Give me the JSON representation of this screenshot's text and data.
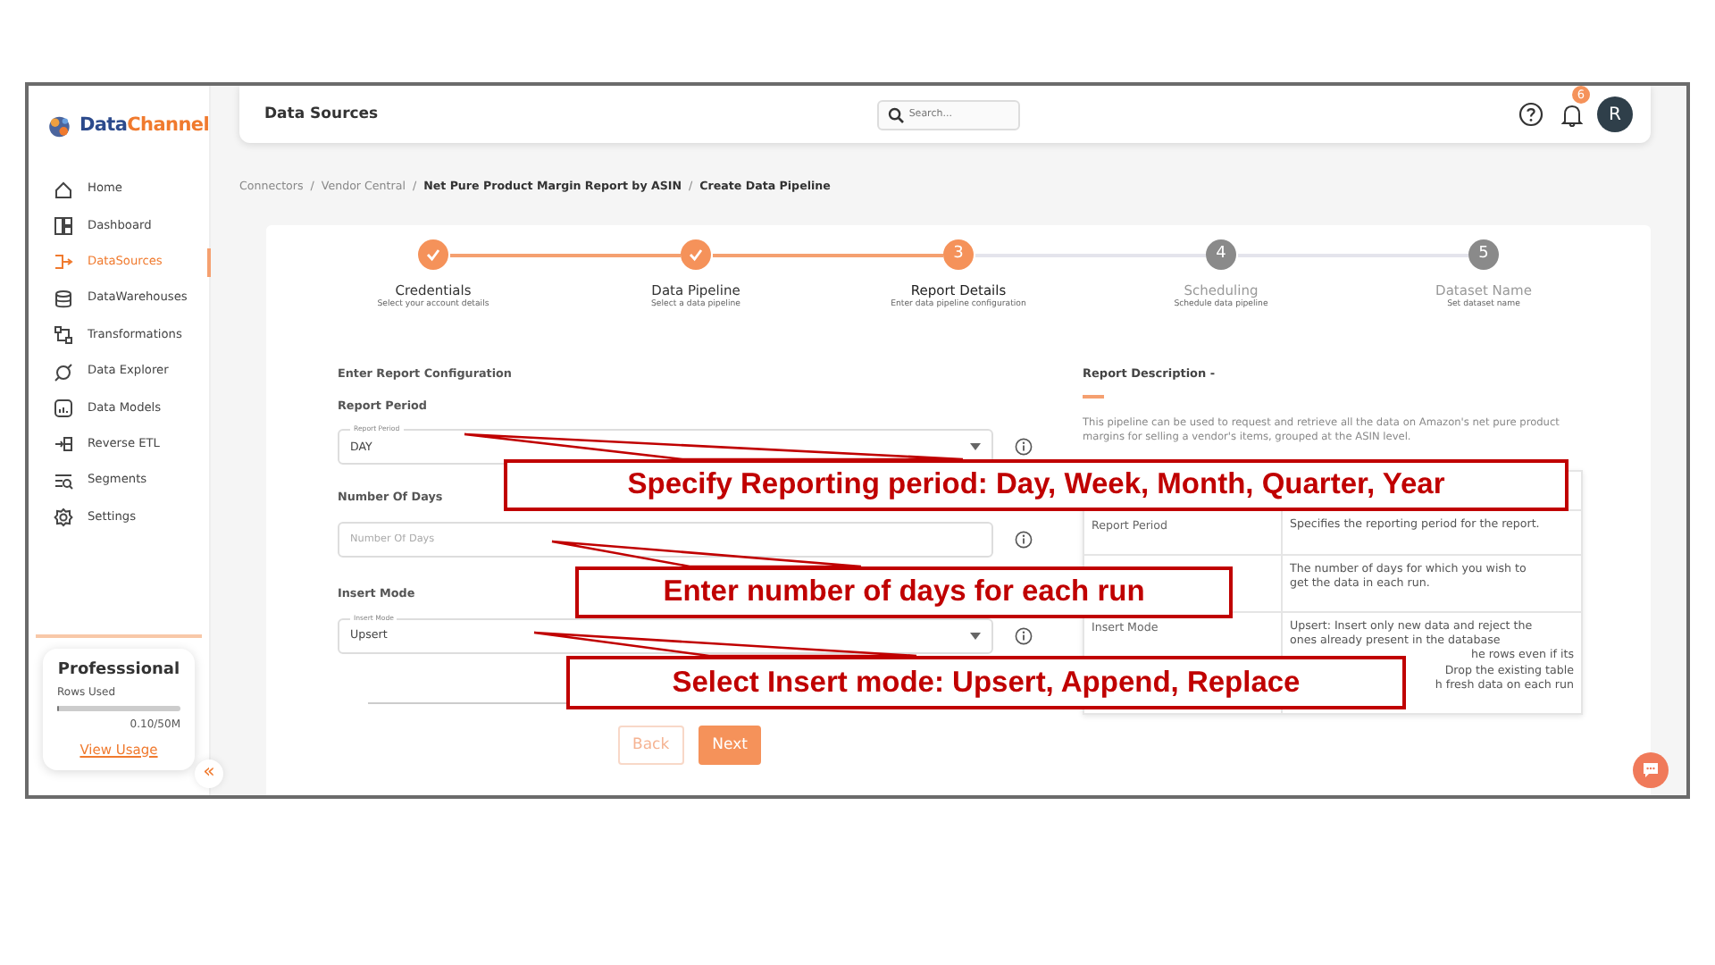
{
  "sidebar": {
    "brand_name": {
      "first": "Data",
      "second": "Channel"
    },
    "items": [
      {
        "label": "Home",
        "selected": false
      },
      {
        "label": "Dashboard",
        "selected": false
      },
      {
        "label": "DataSources",
        "selected": true
      },
      {
        "label": "DataWarehouses",
        "selected": false
      },
      {
        "label": "Transformations",
        "selected": false
      },
      {
        "label": "Data Explorer",
        "selected": false
      },
      {
        "label": "Data Models",
        "selected": false
      },
      {
        "label": "Reverse ETL",
        "selected": false
      },
      {
        "label": "Segments",
        "selected": false
      },
      {
        "label": "Settings",
        "selected": false
      }
    ],
    "plan": {
      "title": "Professsional",
      "usage_label": "Rows Used",
      "level": 0.002,
      "reading": "0.10/50M",
      "link": "View Usage"
    },
    "collapse_glyph": "«"
  },
  "header": {
    "title": "Data Sources",
    "search": {
      "placeholder": "Search..."
    },
    "notification_count": "6",
    "avatar_initial": "R"
  },
  "breadcrumb": [
    {
      "label": "Connectors",
      "current": false
    },
    {
      "separator": "/",
      "label": "Vendor Central",
      "current": false
    },
    {
      "separator": "/",
      "label": "Net Pure Product Margin Report by ASIN",
      "current": true
    },
    {
      "separator": "/",
      "label": "Create Data Pipeline",
      "current": true
    }
  ],
  "stepper": [
    {
      "label": "Credentials",
      "sublabel": "Select your account details",
      "completed": true,
      "active": false
    },
    {
      "label": "Data Pipeline",
      "sublabel": "Select a data pipeline",
      "completed": true,
      "active": false
    },
    {
      "label": "Report Details",
      "sublabel": "Enter data pipeline configuration",
      "completed": false,
      "active": true,
      "number": "3"
    },
    {
      "label": "Scheduling",
      "sublabel": "Schedule data pipeline",
      "completed": false,
      "active": false,
      "number": "4"
    },
    {
      "label": "Dataset Name",
      "sublabel": "Set dataset name",
      "completed": false,
      "active": false,
      "number": "5"
    }
  ],
  "form": {
    "heading": "Enter Report Configuration",
    "fields": [
      {
        "label": "Report Period",
        "kind": "select",
        "floating_label": "Report Period",
        "value": "DAY"
      },
      {
        "label": "Number Of Days",
        "kind": "input",
        "placeholder": "Number Of Days"
      },
      {
        "label": "Insert Mode",
        "kind": "select",
        "floating_label": "Insert Mode",
        "value": "Upsert"
      }
    ],
    "buttons": [
      {
        "label": "Back",
        "kind": "secondary",
        "disabled": true
      },
      {
        "label": "Next",
        "kind": "primary",
        "disabled": false
      }
    ]
  },
  "description": {
    "title": "Report Description -",
    "text": "This pipeline can be used to request and retrieve all the data on Amazon's net pure product margins for selling a vendor's items, grouped at the ASIN level.",
    "rows": [
      {
        "name": "Report Period",
        "lines": [
          {
            "text": "Specifies the reporting period for the report.",
            "cut": false
          }
        ]
      },
      {
        "lines": [
          {
            "text": "The number of days for which you wish to",
            "cut": false
          },
          {
            "text": "get the data in each run.",
            "cut": false
          }
        ]
      },
      {
        "name": "Insert Mode",
        "lines": [
          {
            "text": "Upsert: Insert only new data and reject the",
            "cut": false
          },
          {
            "text": "ones already present in the database",
            "cut": false
          },
          {
            "text": "he rows even if its",
            "cut": true
          },
          {
            "text": "Drop the existing table",
            "cut": true
          },
          {
            "text": "h fresh data on each run",
            "cut": true
          }
        ]
      }
    ]
  },
  "callouts": [
    {
      "text": "Specify Reporting period: Day, Week, Month, Quarter, Year"
    },
    {
      "text": "Enter number of days for each run"
    },
    {
      "text": "Select Insert mode: Upsert, Append, Replace"
    }
  ]
}
